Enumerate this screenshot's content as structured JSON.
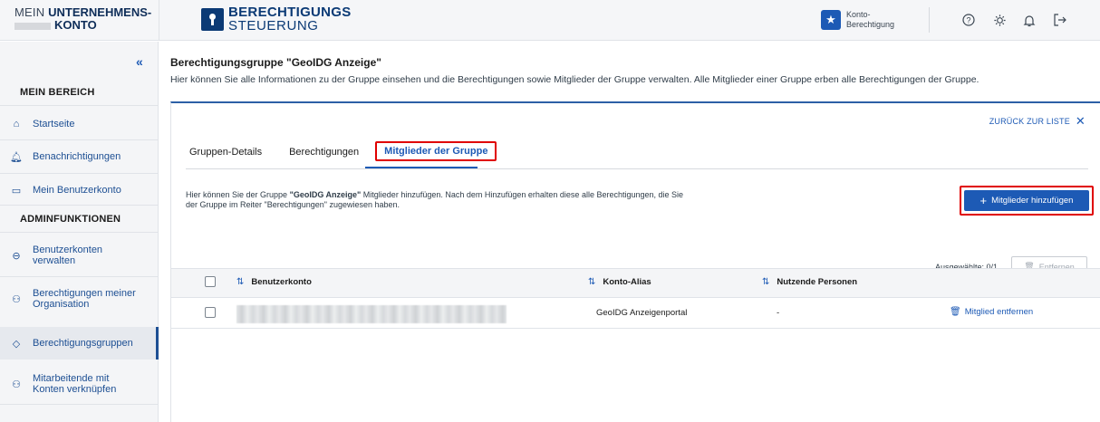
{
  "header": {
    "brand_line1_prefix": "MEIN ",
    "brand_line1_bold": "UNTERNEHMENS-",
    "brand_line2_bold": "KONTO",
    "logo_line1": "BERECHTIGUNGS",
    "logo_line2": "STEUERUNG",
    "konto_line1": "Konto-",
    "konto_line2": "Berechtigung",
    "icons": [
      "help-icon",
      "settings-icon",
      "bell-icon",
      "logout-icon"
    ]
  },
  "sidebar": {
    "collapse_label": "«",
    "section1": "MEIN BEREICH",
    "items1": [
      {
        "label": "Startseite",
        "icon": "home-icon"
      },
      {
        "label": "Benachrichtigungen",
        "icon": "bell-icon"
      },
      {
        "label": "Mein Benutzerkonto",
        "icon": "card-icon"
      }
    ],
    "section2": "ADMINFUNKTIONEN",
    "items2": [
      {
        "label_l1": "Benutzerkonten",
        "label_l2": "verwalten",
        "icon": "users-icon"
      },
      {
        "label_l1": "Berechtigungen meiner",
        "label_l2": "Organisation",
        "icon": "org-icon"
      },
      {
        "label_l1": "Berechtigungsgruppen",
        "label_l2": "",
        "icon": "tag-icon"
      },
      {
        "label_l1": "Mitarbeitende mit",
        "label_l2": "Konten verknüpfen",
        "icon": "link-users-icon"
      }
    ]
  },
  "main": {
    "title": "Berechtigungsgruppe \"GeoIDG Anzeige\"",
    "description": "Hier können Sie alle Informationen zu der Gruppe einsehen und die Berechtigungen sowie Mitglieder der Gruppe verwalten. Alle Mitglieder einer Gruppe erben alle Berechtigungen der Gruppe.",
    "back_label": "ZURÜCK ZUR LISTE",
    "tabs": [
      "Gruppen-Details",
      "Berechtigungen",
      "Mitglieder der Gruppe"
    ],
    "info_pre": "Hier können Sie der Gruppe ",
    "info_bold": "\"GeoIDG Anzeige\"",
    "info_post": " Mitglieder hinzufügen. Nach dem Hinzufügen erhalten diese alle Berechtigungen, die Sie der Gruppe im Reiter \"Berechtigungen\" zugewiesen haben.",
    "add_button": "Mitglieder hinzufügen",
    "selected_label": "Ausgewählte: 0/1",
    "remove_button": "Entfernen",
    "columns": [
      "Benutzerkonto",
      "Konto-Alias",
      "Nutzende Personen"
    ],
    "rows": [
      {
        "account": "",
        "alias": "GeoIDG Anzeigenportal",
        "persons": "-",
        "action": "Mitglied entfernen"
      }
    ]
  }
}
